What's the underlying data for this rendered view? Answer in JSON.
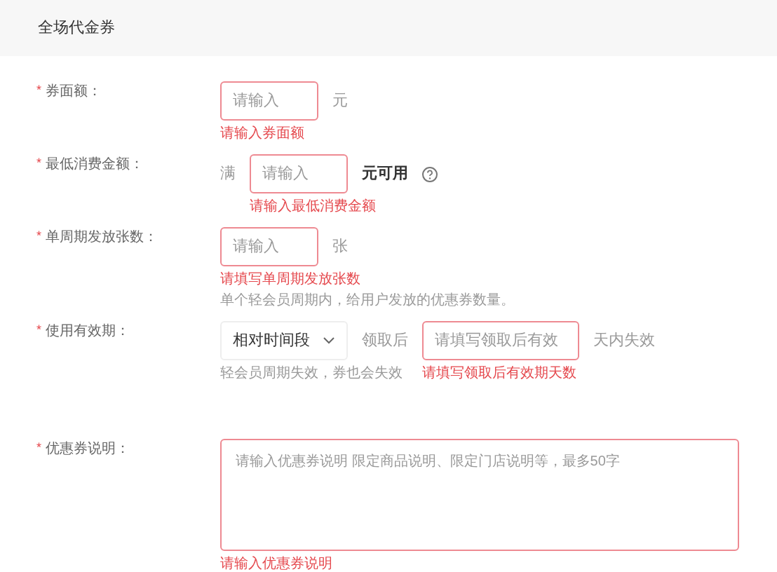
{
  "section": {
    "title": "全场代金券"
  },
  "fields": [
    {
      "label": "券面额：",
      "required_mark": "*",
      "controls": [
        {
          "kind": "input",
          "placeholder": "请输入",
          "invalid": true,
          "notes": [
            {
              "kind": "error",
              "text": "请输入券面额"
            }
          ]
        },
        {
          "kind": "text",
          "text": "元"
        }
      ]
    },
    {
      "label": "最低消费金额：",
      "required_mark": "*",
      "controls": [
        {
          "kind": "text",
          "text": "满"
        },
        {
          "kind": "input",
          "placeholder": "请输入",
          "invalid": true,
          "notes": [
            {
              "kind": "error",
              "text": "请输入最低消费金额"
            }
          ]
        },
        {
          "kind": "strong",
          "text": "元可用"
        },
        {
          "kind": "help_icon"
        }
      ]
    },
    {
      "label": "单周期发放张数：",
      "required_mark": "*",
      "controls": [
        {
          "kind": "input",
          "placeholder": "请输入",
          "invalid": true,
          "notes": [
            {
              "kind": "error",
              "text": "请填写单周期发放张数"
            },
            {
              "kind": "hint",
              "text": "单个轻会员周期内，给用户发放的优惠券数量。"
            }
          ]
        },
        {
          "kind": "text",
          "text": "张"
        }
      ]
    },
    {
      "label": "使用有效期：",
      "required_mark": "*",
      "controls": [
        {
          "kind": "select",
          "value": "相对时间段",
          "notes": [
            {
              "kind": "hint",
              "text": "轻会员周期失效，券也会失效"
            }
          ]
        },
        {
          "kind": "text",
          "text": "领取后"
        },
        {
          "kind": "input",
          "placeholder": "请填写领取后有效",
          "invalid": true,
          "notes": [
            {
              "kind": "error",
              "text": "请填写领取后有效期天数"
            }
          ]
        },
        {
          "kind": "text",
          "text": "天内失效"
        }
      ]
    },
    {
      "label": "优惠券说明：",
      "required_mark": "*",
      "controls": [
        {
          "kind": "textarea",
          "placeholder": "请输入优惠券说明 限定商品说明、限定门店说明等，最多50字",
          "invalid": true,
          "notes": [
            {
              "kind": "error",
              "text": "请输入优惠券说明"
            }
          ]
        }
      ]
    }
  ]
}
